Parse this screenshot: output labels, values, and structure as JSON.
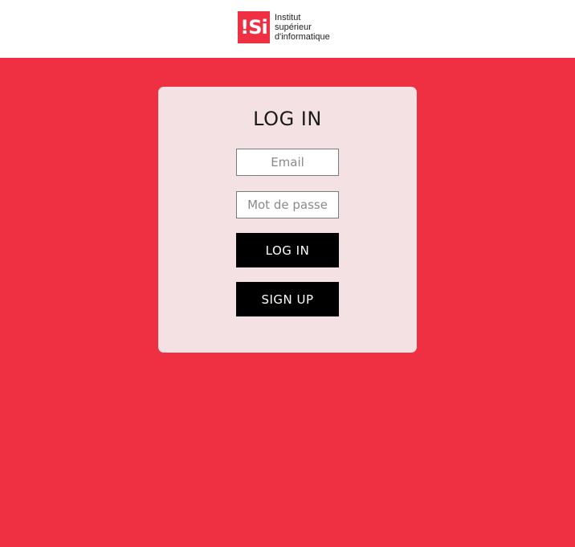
{
  "header": {
    "logo_mark": "!Si",
    "logo_text": "Institut\nsupérieur\nd'informatique"
  },
  "login_card": {
    "title": "LOG IN",
    "email_placeholder": "Email",
    "password_placeholder": "Mot de passe",
    "login_button_label": "LOG IN",
    "signup_button_label": "SIGN UP"
  },
  "colors": {
    "page_background": "#ee3042",
    "header_background": "#ffffff",
    "card_background": "#f3e1e3",
    "button_background": "#000000",
    "brand_red": "#ee3042"
  }
}
